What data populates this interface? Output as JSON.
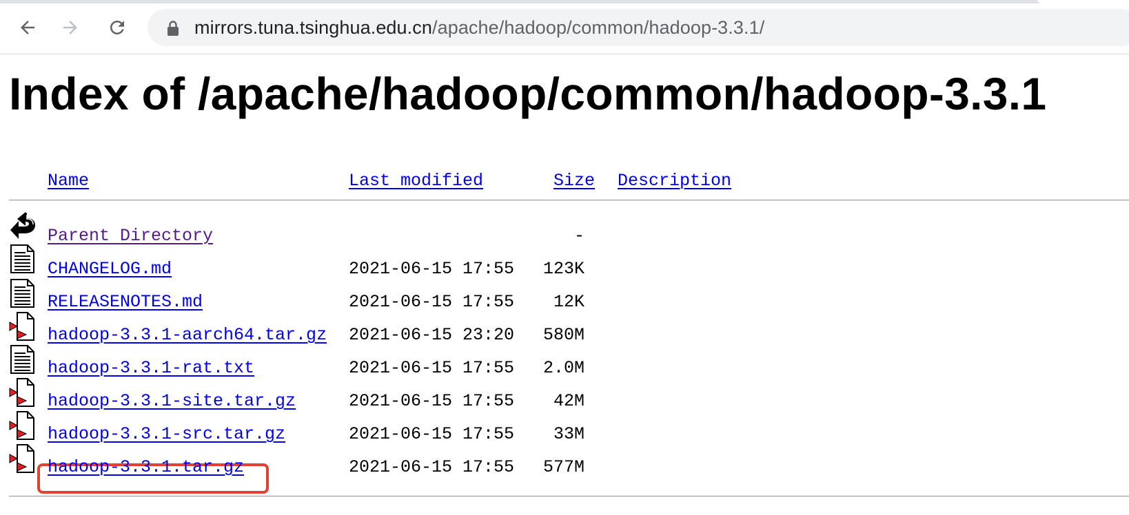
{
  "browser": {
    "url_host": "mirrors.tuna.tsinghua.edu.cn",
    "url_path": "/apache/hadoop/common/hadoop-3.3.1/"
  },
  "page": {
    "title": "Index of /apache/hadoop/common/hadoop-3.3.1"
  },
  "table": {
    "headers": {
      "name": "Name",
      "last_modified": "Last modified",
      "size": "Size",
      "description": "Description"
    },
    "rows": [
      {
        "icon": "back-arrow-icon",
        "name": "Parent Directory",
        "modified": "",
        "size": "-",
        "visited": true
      },
      {
        "icon": "text-file-icon",
        "name": "CHANGELOG.md",
        "modified": "2021-06-15 17:55",
        "size": "123K"
      },
      {
        "icon": "text-file-icon",
        "name": "RELEASENOTES.md",
        "modified": "2021-06-15 17:55",
        "size": "12K"
      },
      {
        "icon": "compressed-file-icon",
        "name": "hadoop-3.3.1-aarch64.tar.gz",
        "modified": "2021-06-15 23:20",
        "size": "580M"
      },
      {
        "icon": "text-file-icon",
        "name": "hadoop-3.3.1-rat.txt",
        "modified": "2021-06-15 17:55",
        "size": "2.0M"
      },
      {
        "icon": "compressed-file-icon",
        "name": "hadoop-3.3.1-site.tar.gz",
        "modified": "2021-06-15 17:55",
        "size": "42M"
      },
      {
        "icon": "compressed-file-icon",
        "name": "hadoop-3.3.1-src.tar.gz",
        "modified": "2021-06-15 17:55",
        "size": "33M"
      },
      {
        "icon": "compressed-file-icon",
        "name": "hadoop-3.3.1.tar.gz",
        "modified": "2021-06-15 17:55",
        "size": "577M",
        "highlighted": true
      }
    ]
  },
  "colors": {
    "link": "#0000ee",
    "visited_link": "#551a8b",
    "highlight_border": "#e0422f"
  }
}
